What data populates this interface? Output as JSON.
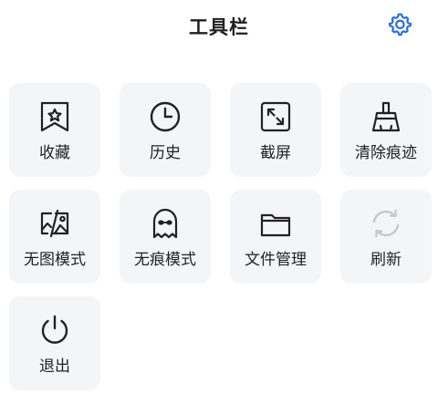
{
  "header": {
    "title": "工具栏",
    "settings_icon": "gear-icon",
    "accent_color": "#2f6fd6"
  },
  "tools": [
    {
      "id": "bookmark",
      "label": "收藏",
      "icon": "bookmark-star-icon"
    },
    {
      "id": "history",
      "label": "历史",
      "icon": "clock-icon"
    },
    {
      "id": "screenshot",
      "label": "截屏",
      "icon": "expand-arrows-icon"
    },
    {
      "id": "clear-traces",
      "label": "清除痕迹",
      "icon": "broom-icon"
    },
    {
      "id": "no-image-mode",
      "label": "无图模式",
      "icon": "image-off-icon"
    },
    {
      "id": "incognito-mode",
      "label": "无痕模式",
      "icon": "ghost-icon"
    },
    {
      "id": "file-manager",
      "label": "文件管理",
      "icon": "folder-icon"
    },
    {
      "id": "refresh",
      "label": "刷新",
      "icon": "refresh-icon",
      "disabled": true
    },
    {
      "id": "exit",
      "label": "退出",
      "icon": "power-icon"
    }
  ]
}
